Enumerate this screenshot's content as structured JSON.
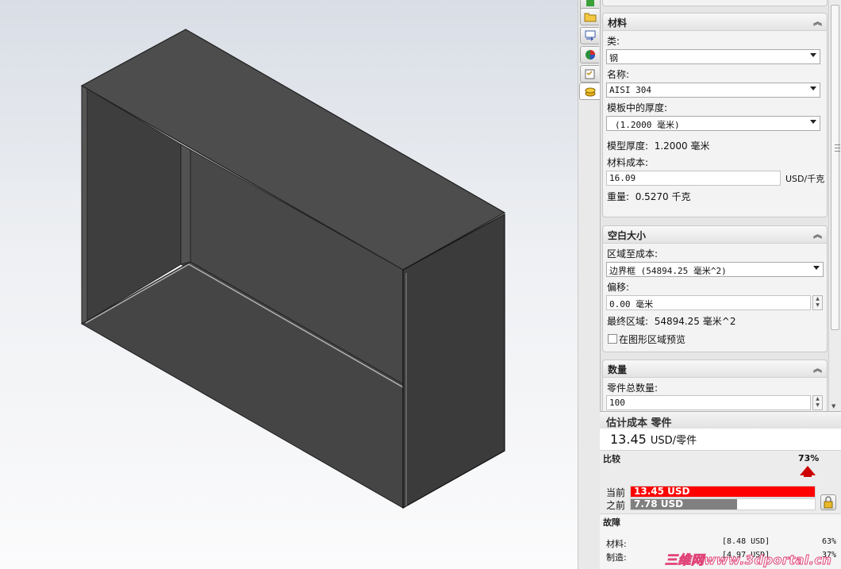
{
  "material": {
    "title": "材料",
    "class_label": "类:",
    "class_value": "钢",
    "name_label": "名称:",
    "name_value": "AISI 304",
    "template_thickness_label": "模板中的厚度:",
    "template_thickness_value": "(1.2000 毫米)",
    "model_thickness_label": "模型厚度:",
    "model_thickness_value": "1.2000 毫米",
    "cost_label": "材料成本:",
    "cost_value": "16.09",
    "cost_unit": "USD/千克",
    "weight_label": "重量:",
    "weight_value": "0.5270 千克"
  },
  "blank": {
    "title": "空白大小",
    "area_label": "区域至成本:",
    "area_value": "边界框 (54894.25 毫米^2)",
    "offset_label": "偏移:",
    "offset_value": "0.00 毫米",
    "final_area_label": "最终区域:",
    "final_area_value": "54894.25 毫米^2",
    "preview_label": "在图形区域预览"
  },
  "quantity": {
    "title": "数量",
    "total_label": "零件总数量:",
    "total_value": "100"
  },
  "estimate": {
    "title": "估计成本 零件",
    "value": "13.45",
    "unit": "USD/零件"
  },
  "compare": {
    "title": "比较",
    "percent": "73%",
    "current_label": "当前",
    "current_value": "13.45 USD",
    "current_fraction": 1.0,
    "previous_label": "之前",
    "previous_value": "7.78 USD",
    "previous_fraction": 0.578,
    "current_color": "#ff0000",
    "previous_color": "#808080"
  },
  "breakdown": {
    "title": "故障",
    "rows": [
      {
        "label": "材料:",
        "value": "[8.48 USD]",
        "percent": "63%"
      },
      {
        "label": "制造:",
        "value": "[4.97 USD]",
        "percent": "37%"
      }
    ]
  },
  "watermark": "三维网www.3dportal.cn",
  "icons": [
    "green-tab-icon",
    "folder-icon",
    "display-manager-icon",
    "appearance-icon",
    "checklist-icon",
    "costing-coins-icon",
    "lock-icon"
  ],
  "colors": {
    "part_dark": "#3f3f3f",
    "part_face": "#4a4a4a",
    "panel_bg": "#e6e6e6"
  }
}
